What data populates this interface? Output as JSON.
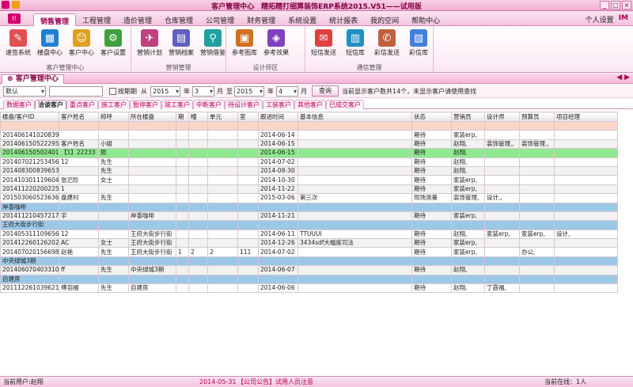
{
  "window": {
    "title": "客户管理中心　精拓精打细算装饰ERP系统2015.V51——试用版",
    "controls": [
      "_",
      "□",
      "×"
    ]
  },
  "menu": {
    "logo": "I!",
    "tabs": [
      "销售管理",
      "工程管理",
      "造价管理",
      "仓库管理",
      "公司管理",
      "财务管理",
      "系统设置",
      "统计报表",
      "我的空间",
      "帮助中心"
    ],
    "active_tab": "销售管理",
    "right": {
      "settings": "个人设置",
      "im": "IM"
    }
  },
  "ribbon": {
    "groups": [
      {
        "name": "客户管理中心",
        "items": [
          "速签系统",
          "楼盘中心",
          "客户中心",
          "客户设置"
        ]
      },
      {
        "name": "营销管理",
        "items": [
          "营销计划",
          "营销档案",
          "营销借鉴"
        ]
      },
      {
        "name": "设计师区",
        "items": [
          "参考图库",
          "参考效果"
        ]
      },
      {
        "name": "通信管理",
        "items": [
          "短信发送",
          "短信库",
          "彩信发送",
          "彩信库"
        ]
      }
    ]
  },
  "panel": {
    "title": "客户管理中心",
    "nav": "◀ ▶"
  },
  "filter": {
    "preset": "默认",
    "search_value": "",
    "date_checkbox_label": "按期期",
    "from_label": "从",
    "from_year": "2015",
    "year_label": "年",
    "from_month": "3",
    "month_label": "月",
    "to_label": "至",
    "to_year": "2015",
    "to_month": "4",
    "query_button": "查询",
    "hint": "当前显示客户数共14个，未显示客户请使用查找"
  },
  "subtabs": [
    "数据客户",
    "洽谈客户",
    "重点客户",
    "施工客户",
    "暂停客户",
    "竣工客户",
    "中断客户",
    "待设计客户",
    "工装客户",
    "其他客户",
    "已成交客户"
  ],
  "active_subtab": "洽谈客户",
  "table": {
    "columns": [
      "楼盘/客户ID",
      "客户姓名",
      "称呼",
      "所在楼盘",
      "期",
      "幢",
      "单元",
      "室",
      "跟进时间",
      "基本信息",
      "状态",
      "营销员",
      "设计师",
      "预算员",
      "项目经理"
    ],
    "rows": [
      {
        "type": "pink",
        "cells": [
          "",
          "",
          "",
          "",
          "",
          "",
          "",
          "",
          "",
          "",
          "",
          "",
          "",
          "",
          ""
        ]
      },
      {
        "type": "normal",
        "cells": [
          "2014061410208396",
          "",
          "",
          "",
          "",
          "",
          "",
          "",
          "2014-06-14",
          "",
          "期待",
          "家装erp,",
          "",
          "",
          ""
        ]
      },
      {
        "type": "normal",
        "cells": [
          "2014061505222958",
          "客户姓名",
          "小姐",
          "",
          "",
          "",
          "",
          "",
          "2014-06-15",
          "",
          "期待",
          "赵翔,",
          "装饰管理,,",
          "装饰管理,,",
          ""
        ]
      },
      {
        "type": "green",
        "cells": [
          "2014061505024016",
          "【1】22233",
          "熙",
          "",
          "",
          "",
          "",
          "",
          "2014-06-15",
          "",
          "期待",
          "赵翔,",
          "",
          "",
          ""
        ]
      },
      {
        "type": "normal",
        "cells": [
          "2014070212534567",
          "12",
          "先生",
          "",
          "",
          "",
          "",
          "",
          "2014-07-02",
          "",
          "期待",
          "赵翔,",
          "",
          "",
          ""
        ]
      },
      {
        "type": "normal",
        "cells": [
          "2014083008396533",
          "",
          "先生",
          "",
          "",
          "",
          "",
          "",
          "2014-08-30",
          "",
          "期待",
          "赵翔,",
          "",
          "",
          ""
        ]
      },
      {
        "type": "normal",
        "cells": [
          "2014103011196046",
          "张汜珍",
          "女士",
          "",
          "",
          "",
          "",
          "",
          "2014-10-30",
          "",
          "期待",
          "家装erp,",
          "",
          "",
          ""
        ]
      },
      {
        "type": "normal",
        "cells": [
          "2014112202002250",
          "1",
          "",
          "",
          "",
          "",
          "",
          "",
          "2014-11-22",
          "",
          "期待",
          "家装erp,",
          "",
          "",
          ""
        ]
      },
      {
        "type": "normal",
        "cells": [
          "2015030605236367",
          "盘建村",
          "先生",
          "",
          "",
          "",
          "",
          "",
          "2015-03-06",
          "第三次",
          "现场测量",
          "装饰管理,",
          "设计,,",
          "",
          ""
        ]
      },
      {
        "type": "group",
        "cells": [
          "岸香咖啡",
          "",
          "",
          "",
          "",
          "",
          "",
          "",
          "",
          "",
          "",
          "",
          "",
          "",
          ""
        ]
      },
      {
        "type": "normal",
        "cells": [
          "2014112104572177",
          "宇",
          "",
          "岸香咖啡",
          "",
          "",
          "",
          "",
          "2014-11-21",
          "",
          "期待",
          "家装erp,",
          "",
          "",
          ""
        ]
      },
      {
        "type": "group",
        "cells": [
          "王府大街步行街",
          "",
          "",
          "",
          "",
          "",
          "",
          "",
          "",
          "",
          "",
          "",
          "",
          "",
          ""
        ]
      },
      {
        "type": "normal",
        "cells": [
          "2014053111096563",
          "12",
          "",
          "王府大街步行街",
          "",
          "",
          "",
          "",
          "2014-06-11",
          "TTUUUI",
          "期待",
          "赵翔,",
          "家装erp,",
          "家装erp,",
          "设计,"
        ]
      },
      {
        "type": "normal",
        "cells": [
          "2014122601262026",
          "AC",
          "女士",
          "王府大街步行街",
          "",
          "",
          "",
          "",
          "2014-12-26",
          "3434sdf大幅度司法",
          "期待",
          "家装erp,",
          "",
          "",
          ""
        ]
      },
      {
        "type": "normal",
        "cells": [
          "2014070201566980",
          "赵艳",
          "先生",
          "王府大街步行街",
          "1",
          "2",
          "2",
          "111",
          "2014-07-02",
          "",
          "期待",
          "家装erp,",
          "",
          "办公,",
          ""
        ]
      },
      {
        "type": "group",
        "cells": [
          "中央绿城3期",
          "",
          "",
          "",
          "",
          "",
          "",
          "",
          "",
          "",
          "",
          "",
          "",
          "",
          ""
        ]
      },
      {
        "type": "normal",
        "cells": [
          "2014060704033101",
          "ff",
          "先生",
          "中央绿城3期",
          "",
          "",
          "",
          "",
          "2014-06-07",
          "",
          "期待",
          "赵翔,",
          "",
          "",
          ""
        ]
      },
      {
        "type": "group",
        "cells": [
          "自建房",
          "",
          "",
          "",
          "",
          "",
          "",
          "",
          "",
          "",
          "",
          "",
          "",
          "",
          ""
        ]
      },
      {
        "type": "normal",
        "cells": [
          "2011122610396216",
          "傅羽福",
          "先生",
          "自建房",
          "",
          "",
          "",
          "",
          "2014-06-06",
          "",
          "期待",
          "赵翔,",
          "丁霞福,",
          "",
          ""
        ]
      }
    ]
  },
  "status": {
    "user": "当前用户:赵翔",
    "date": "2014-05-31",
    "notice": "【公司公告】试用人员注意",
    "online": "当前在线：1人"
  },
  "colors": {
    "accent": "#a00050",
    "group_row": "#9cc8e8",
    "highlight_row": "#90e890",
    "pink_row": "#fbd6c8"
  }
}
